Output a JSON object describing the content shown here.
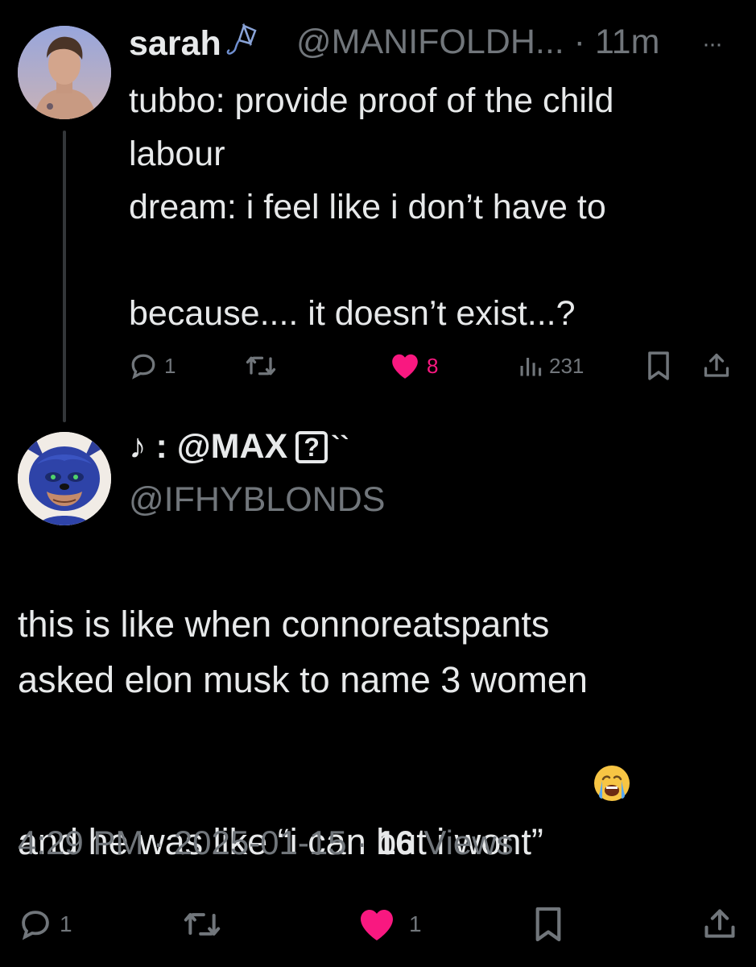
{
  "parent_post": {
    "display_name": "sarah",
    "handle_time": "@MANIFOLDH... · 11m",
    "more_label": "···",
    "text": "tubbo: provide proof of the child\nlabour\ndream: i feel like i don’t have to\n\nbecause.... it doesn’t exist...?",
    "replies": "1",
    "likes": "8",
    "views": "231"
  },
  "reply_post": {
    "display_name": "♪ : @MAX",
    "name_box": "?",
    "name_suffix": "``",
    "handle": "@IFHYBLONDS",
    "text": "this is like when connoreatspants\nasked elon musk to name 3 women\nand he was like “i can but i wont”",
    "time": "4:29 PM",
    "date": "2025-01-15",
    "views_count": "16",
    "views_label": "Views",
    "replies": "1",
    "likes": "1"
  },
  "colors": {
    "background": "#000000",
    "text": "#e7e9ea",
    "muted": "#71767b",
    "like": "#f91880"
  },
  "icons": [
    "reply-icon",
    "retweet-icon",
    "heart-icon",
    "views-icon",
    "bookmark-icon",
    "share-icon",
    "kite-icon",
    "crying-emoji"
  ]
}
